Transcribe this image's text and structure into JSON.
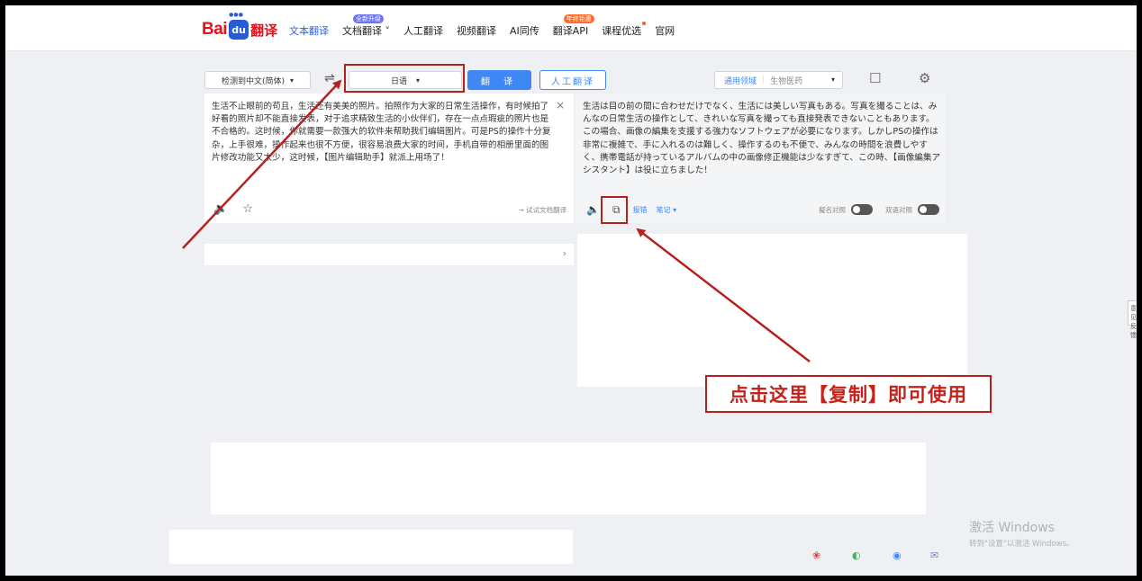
{
  "logo": {
    "bai": "Bai",
    "du": "du",
    "fanyi": "翻译"
  },
  "nav": {
    "items": [
      "文本翻译",
      "文档翻译",
      "人工翻译",
      "视频翻译",
      "AI同传",
      "翻译API",
      "课程优选",
      "官网"
    ],
    "badge_doc": "全新升级",
    "badge_api": "年终钜惠"
  },
  "toolbar": {
    "source_lang": "检测到中文(简体)",
    "swap": "⇌",
    "target_lang": "日语",
    "translate_btn": "翻 译",
    "human_btn": "人工翻译",
    "domain_general": "通用领域",
    "domain_bio": "生物医药",
    "caret": "▾"
  },
  "source": {
    "text": "生活不止眼前的苟且，生活还有美美的照片。拍照作为大家的日常生活操作，有时候拍了好看的照片却不能直接发表，对于追求精致生活的小伙伴们，存在一点点瑕疵的照片也是不合格的。这时候，你就需要一款强大的软件来帮助我们编辑图片。可是PS的操作十分复杂，上手很难，操作起来也很不方便，很容易浪费大家的时间，手机自带的相册里面的图片修改功能又太少，这时候，【图片编辑助手】就派上用场了！",
    "close": "×",
    "speaker": "🔈",
    "star": "☆",
    "try_doc": "→ 试试文档翻译"
  },
  "target": {
    "text": "生活は目の前の間に合わせだけでなく、生活には美しい写真もある。写真を撮ることは、みんなの日常生活の操作として、きれいな写真を撮っても直接発表できないこともあります。この場合、画像の編集を支援する強力なソフトウェアが必要になります。しかしPSの操作は非常に複雑で、手に入れるのは難しく、操作するのも不便で、みんなの時間を浪費しやすく、携帯電話が持っているアルバムの中の画像修正機能は少なすぎて、この時、【画像編集アシスタント】は役に立ちました！",
    "speaker": "🔈",
    "copy": "⧉",
    "report": "报错",
    "notes": "笔记 ▾",
    "toggle1": "擬名対照",
    "toggle2": "双语对照"
  },
  "left_bar_chevron": "›",
  "side_tab": "意见反馈",
  "watermark": {
    "line1": "激活 Windows",
    "line2": "转到\"设置\"以激活 Windows。"
  },
  "social": {
    "weibo": "❀",
    "wechat": "◐",
    "qq": "◉",
    "mail": "✉"
  },
  "callout": "点击这里【复制】即可使用",
  "colors": {
    "accent": "#3f87f5",
    "annotation_red": "#b5221c",
    "brand_red": "#e0121b"
  }
}
